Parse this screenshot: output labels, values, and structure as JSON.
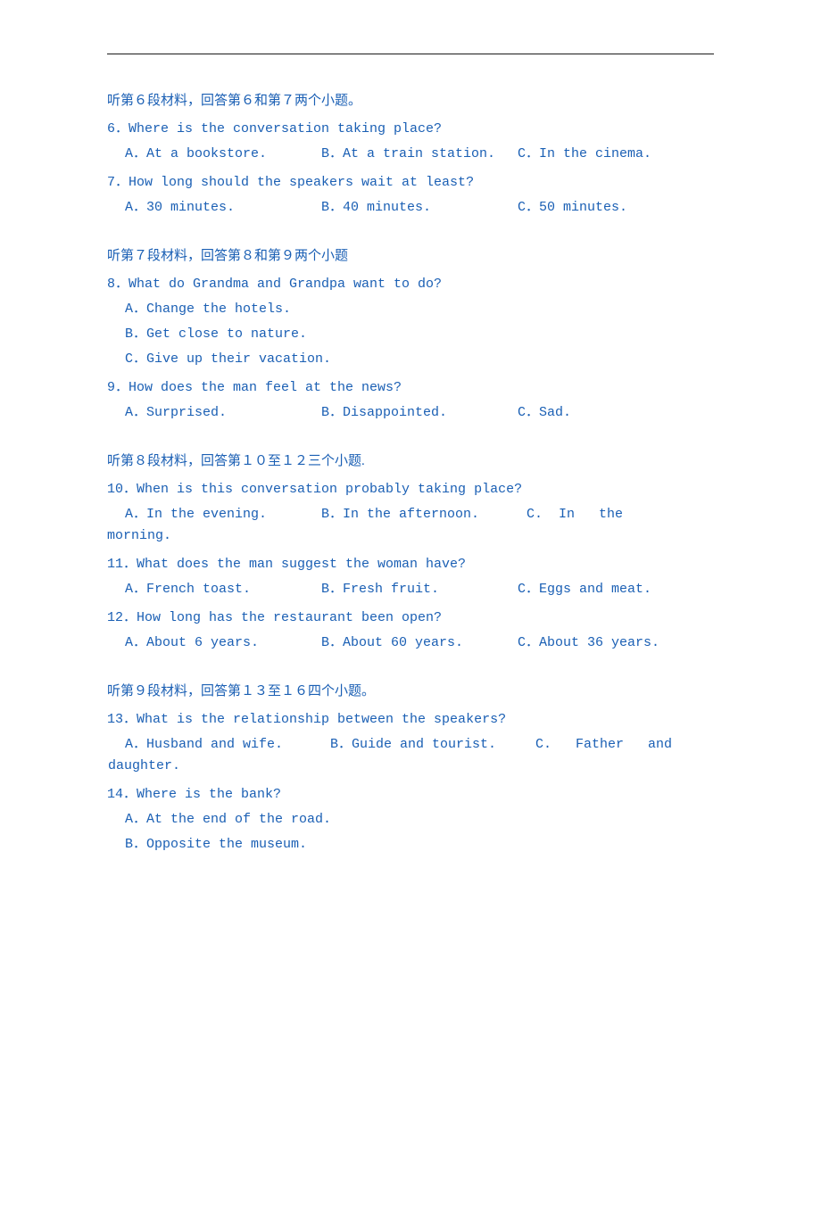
{
  "topLine": true,
  "sections": [
    {
      "id": "section6",
      "header": "听第６段材料，回答第６和第７两个小题。",
      "questions": [
        {
          "id": "q6",
          "text": "6．Where is the conversation taking place?",
          "optionsType": "row",
          "options": [
            "A．At a bookstore.",
            "B．At a train station.",
            "C．In the cinema."
          ]
        },
        {
          "id": "q7",
          "text": "7．How long should the speakers wait at least?",
          "optionsType": "row",
          "options": [
            "A．30 minutes.",
            "B．40 minutes.",
            "C．50 minutes."
          ]
        }
      ]
    },
    {
      "id": "section7",
      "header": "听第７段材料，回答第８和第９两个小题",
      "questions": [
        {
          "id": "q8",
          "text": "8．What do Grandma and Grandpa want to do?",
          "optionsType": "block",
          "options": [
            "A．Change the hotels.",
            "B．Get close to nature.",
            "C．Give up their vacation."
          ]
        },
        {
          "id": "q9",
          "text": "9．How does the man feel at the news?",
          "optionsType": "row",
          "options": [
            "A．Surprised.",
            "B．Disappointed.",
            "C．Sad."
          ]
        }
      ]
    },
    {
      "id": "section8",
      "header": "听第８段材料，回答第１０至１２三个小题.",
      "questions": [
        {
          "id": "q10",
          "text": "10．When is this conversation probably taking place?",
          "optionsType": "row-wrap",
          "options": [
            "A．In the evening.",
            "B．In the afternoon.",
            "C．In the morning."
          ],
          "wrapStart": 2,
          "wrapText": "morning."
        },
        {
          "id": "q11",
          "text": "11．What does the man suggest the woman have?",
          "optionsType": "row",
          "options": [
            "A．French toast.",
            "B．Fresh fruit.",
            "C．Eggs and meat."
          ]
        },
        {
          "id": "q12",
          "text": "12．How long has the restaurant been open?",
          "optionsType": "row",
          "options": [
            "A．About 6 years.",
            "B．About 60 years.",
            "C．About 36 years."
          ]
        }
      ]
    },
    {
      "id": "section9",
      "header": "听第９段材料，回答第１３至１６四个小题。",
      "questions": [
        {
          "id": "q13",
          "text": "13．What is the relationship between the speakers?",
          "optionsType": "row-wrap2",
          "options": [
            "A．Husband and wife.",
            "B．Guide and tourist.",
            "C．Father and daughter."
          ]
        },
        {
          "id": "q14",
          "text": "14．Where is the bank?",
          "optionsType": "block",
          "options": [
            "A．At the end of the road.",
            "B．Opposite the museum."
          ]
        }
      ]
    }
  ]
}
